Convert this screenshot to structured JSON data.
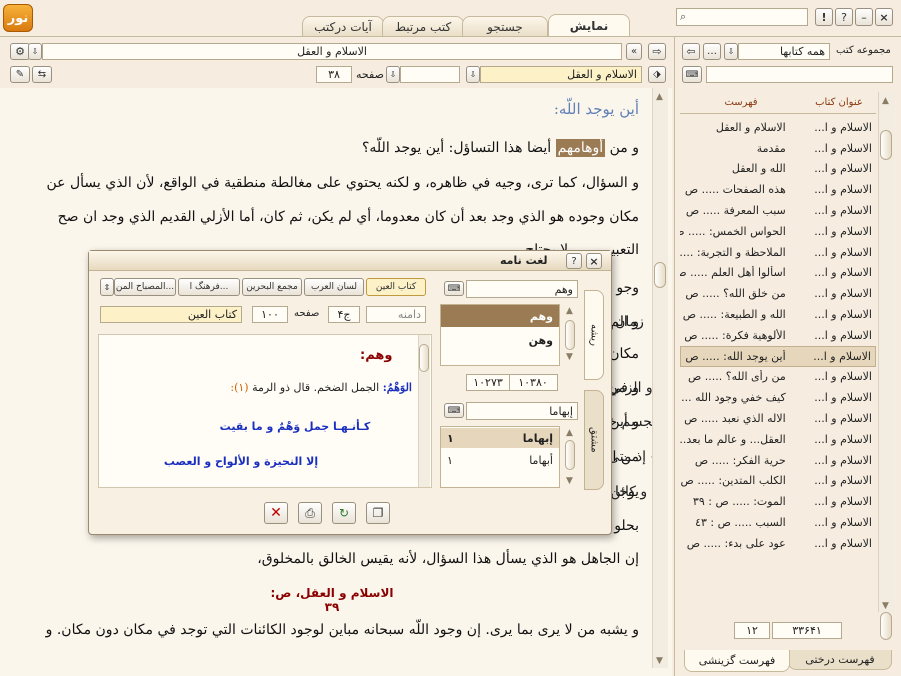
{
  "logo": "نور",
  "tabs": [
    {
      "label": "نمایش"
    },
    {
      "label": "جستجو"
    },
    {
      "label": "کتب مرتبط"
    },
    {
      "label": "آیات درکتب"
    }
  ],
  "window_controls": {
    "close": "×",
    "help": "?",
    "info": "!"
  },
  "sidebar": {
    "collection_label": "مجموعه کتب",
    "collection_value": "همه کتابها",
    "search_value": "",
    "col_header_book": "عنوان کتاب",
    "col_header_index": "فهرست",
    "rows": [
      {
        "book": "الاسلام و ا...",
        "index": "الاسلام و العقل"
      },
      {
        "book": "الاسلام و ا...",
        "index": "مقدمة"
      },
      {
        "book": "الاسلام و ا...",
        "index": "الله و العقل"
      },
      {
        "book": "الاسلام و ا...",
        "index": "هذه الصفحات ..... ص"
      },
      {
        "book": "الاسلام و ا...",
        "index": "سبب المعرفة ..... ص"
      },
      {
        "book": "الاسلام و ا...",
        "index": "الحواس الخمس: ..... ص"
      },
      {
        "book": "الاسلام و ا...",
        "index": "الملاحظة و التجربة: ....."
      },
      {
        "book": "الاسلام و ا...",
        "index": "اسألوا أهل العلم ..... ص"
      },
      {
        "book": "الاسلام و ا...",
        "index": "من خلق الله؟ ..... ص"
      },
      {
        "book": "الاسلام و ا...",
        "index": "الله و الطبيعة: ..... ص"
      },
      {
        "book": "الاسلام و ا...",
        "index": "الألوهية فكرة: ..... ص"
      },
      {
        "book": "الاسلام و ا...",
        "index": "أين يوجد الله: ..... ص"
      },
      {
        "book": "الاسلام و ا...",
        "index": "من رأى الله؟ ..... ص"
      },
      {
        "book": "الاسلام و ا...",
        "index": "كيف خفي وجود الله ....."
      },
      {
        "book": "الاسلام و ا...",
        "index": "الاله الذي نعبد ..... ص"
      },
      {
        "book": "الاسلام و ا...",
        "index": "العقل... و عالم ما بعد..."
      },
      {
        "book": "الاسلام و ا...",
        "index": "حرية الفكر: ..... ص"
      },
      {
        "book": "الاسلام و ا...",
        "index": "الكلب المتدين: ..... ص"
      },
      {
        "book": "الاسلام و ا...",
        "index": "الموت: ..... ص : ٣٩"
      },
      {
        "book": "الاسلام و ا...",
        "index": "السبب ..... ص : ٤٣"
      },
      {
        "book": "الاسلام و ا...",
        "index": "عود على بدء: ..... ص"
      }
    ],
    "status_a": "۳۳۶۴۱",
    "status_b": "۱۲",
    "bottom_tab_tree": "فهرست درختی",
    "bottom_tab_select": "فهرست گزینشی"
  },
  "toolbar": {
    "breadcrumb": "الاسلام و العقل",
    "book_field": "الاسلام و العقل",
    "page_label": "صفحه",
    "page_value": "۳۸"
  },
  "content": {
    "heading": "أين يوجد اللّه:",
    "line1_pre": "و من",
    "line1_highlight": "أوهامهم",
    "line1_post": "أيضا هذا التساؤل: أين يوجد اللّه؟",
    "line2": "و السؤال، كما ترى، وجيه في ظاهره، و لكنه يحتوي على مغالطة منطقية في الواقع، لأن الذي يسأل عن",
    "line3": "مكان وجوده هو الذي وجد بعد أن كان معدوما، أي لم يكن، ثم كان، أما الأزلي القديم الذي وجد ان صح",
    "line4": "التعبير ...... لا يحتاج",
    "line5": "وجو",
    "line6_start": "و الم",
    "line6_end": "زمان أو",
    "line7": "مكان",
    "line8_start": "و في",
    "line8_end": "و الزمن؟",
    "line9_start": "و أين",
    "line9_end": "لجسم خلا",
    "line10_start": "من ال",
    "line10_end": "» إذ متى لم",
    "line11_start": "يوجا",
    "line11_end": "و كائن لا",
    "line12": "بحلو",
    "line13": "إن الجاهل هو الذي يسأل هذا السؤال، لأنه يقيس الخالق بالمخلوق،",
    "citation": "الاسلام و العقل، ص: ٣٩",
    "line14": "و يشبه من لا يرى بما يرى. إن وجود اللّه سبحانه مباين لوجود الكائنات التي توجد في مكان دون مكان. و"
  },
  "dialog": {
    "title": "لغت نامه",
    "side_tab_root": "ریشه",
    "side_tab_derived": "مشتق",
    "root_input": "وهم",
    "root_list": [
      "وهم",
      "وهن"
    ],
    "root_count_a": "۱۰۳۸۰",
    "root_count_b": "۱۰۲۷۳",
    "derived_input": "إبهاما",
    "derived_list": [
      {
        "word": "إبهاما",
        "num": "۱"
      },
      {
        "word": "أبهاما",
        "num": "۱"
      }
    ],
    "dict_tabs": [
      "کتاب العين",
      "لسان العرب",
      "مجمع البحرين",
      "فرهنگ ا...",
      "المصباح المن..."
    ],
    "book_field": "کتاب العين",
    "page_label": "صفحه",
    "page_value": "۱۰۰",
    "volume_value": "ج۴",
    "range_label": "دامنه",
    "entry_headword": "وهم:",
    "entry_line1_word": "الوَهْمُ:",
    "entry_line1_text": "الجمل الضخم. قال ذو الرمة",
    "entry_line1_ref": "(۱):",
    "verse1": "كـأنـهـا جمل وَهْمٌ و ما بقيت",
    "verse2": "إلا النحيزة و الألواح و العصب"
  },
  "colors": {
    "accent_orange": "#f0a020",
    "highlight_brown": "#9b7b54",
    "citation_red": "#8b0000",
    "verse_blue": "#1a2fc0",
    "heading_blue": "#6080b8"
  }
}
